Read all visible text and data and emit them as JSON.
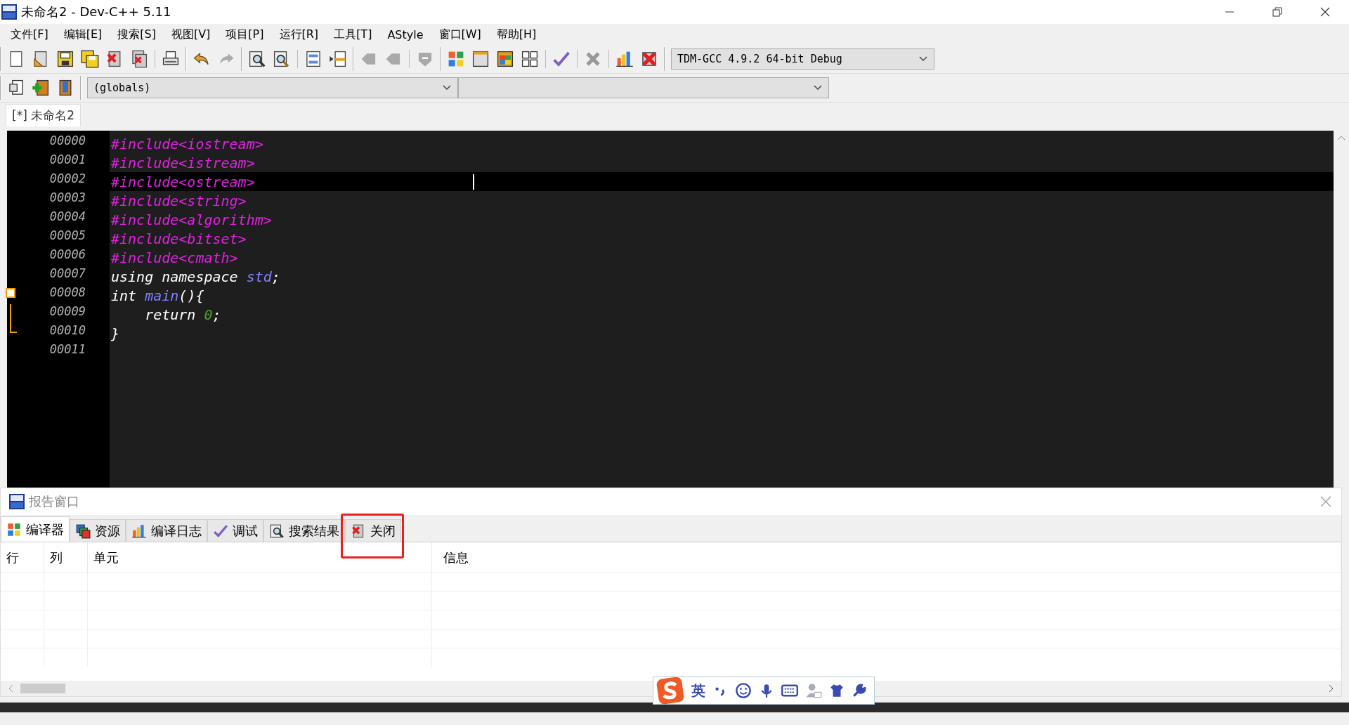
{
  "window": {
    "title": "未命名2 - Dev-C++ 5.11"
  },
  "menu": [
    "文件[F]",
    "编辑[E]",
    "搜索[S]",
    "视图[V]",
    "项目[P]",
    "运行[R]",
    "工具[T]",
    "AStyle",
    "窗口[W]",
    "帮助[H]"
  ],
  "compiler_select": {
    "value": "TDM-GCC 4.9.2 64-bit Debug"
  },
  "scope_select": {
    "value": "(globals)"
  },
  "file_tabs": [
    {
      "label": "[*] 未命名2",
      "selected": true
    }
  ],
  "editor": {
    "lines": [
      {
        "number": "00000",
        "current": false,
        "kind": "plain",
        "tokens": [
          {
            "text": "#include<iostream>",
            "kind": "directive"
          }
        ]
      },
      {
        "number": "00001",
        "current": false,
        "kind": "plain",
        "tokens": [
          {
            "text": "#include<istream>",
            "kind": "directive"
          }
        ]
      },
      {
        "number": "00002",
        "current": true,
        "kind": "plain",
        "tokens": [
          {
            "text": "#include<ostream>",
            "kind": "directive"
          }
        ]
      },
      {
        "number": "00003",
        "current": false,
        "kind": "plain",
        "tokens": [
          {
            "text": "#include<string>",
            "kind": "directive"
          }
        ]
      },
      {
        "number": "00004",
        "current": false,
        "kind": "plain",
        "tokens": [
          {
            "text": "#include<algorithm>",
            "kind": "directive"
          }
        ]
      },
      {
        "number": "00005",
        "current": false,
        "kind": "plain",
        "tokens": [
          {
            "text": "#include<bitset>",
            "kind": "directive"
          }
        ]
      },
      {
        "number": "00006",
        "current": false,
        "kind": "plain",
        "tokens": [
          {
            "text": "#include<cmath>",
            "kind": "directive"
          }
        ]
      },
      {
        "number": "00007",
        "current": false,
        "kind": "plain",
        "tokens": [
          {
            "text": "using namespace ",
            "kind": "plain"
          },
          {
            "text": "std",
            "kind": "ident"
          },
          {
            "text": ";",
            "kind": "plain"
          }
        ]
      },
      {
        "number": "00008",
        "current": false,
        "kind": "foldstart",
        "tokens": [
          {
            "text": "int ",
            "kind": "plain"
          },
          {
            "text": "main",
            "kind": "ident"
          },
          {
            "text": "(){",
            "kind": "plain"
          }
        ]
      },
      {
        "number": "00009",
        "current": false,
        "kind": "foldbody",
        "tokens": [
          {
            "text": "    return ",
            "kind": "plain"
          },
          {
            "text": "0",
            "kind": "number"
          },
          {
            "text": ";",
            "kind": "plain"
          }
        ]
      },
      {
        "number": "00010",
        "current": false,
        "kind": "foldend",
        "tokens": [
          {
            "text": "}",
            "kind": "plain"
          }
        ]
      },
      {
        "number": "00011",
        "current": false,
        "kind": "plain"
      }
    ]
  },
  "report": {
    "title": "报告窗口",
    "tabs": [
      {
        "label": "编译器",
        "selected": true
      },
      {
        "label": "资源",
        "selected": false
      },
      {
        "label": "编译日志",
        "selected": false
      },
      {
        "label": "调试",
        "selected": false
      },
      {
        "label": "搜索结果",
        "selected": false
      },
      {
        "label": "关闭",
        "selected": false,
        "highlighted": true
      }
    ],
    "columns": [
      "行",
      "列",
      "单元",
      "信息"
    ]
  },
  "ime_bar": {
    "mode": "英"
  }
}
